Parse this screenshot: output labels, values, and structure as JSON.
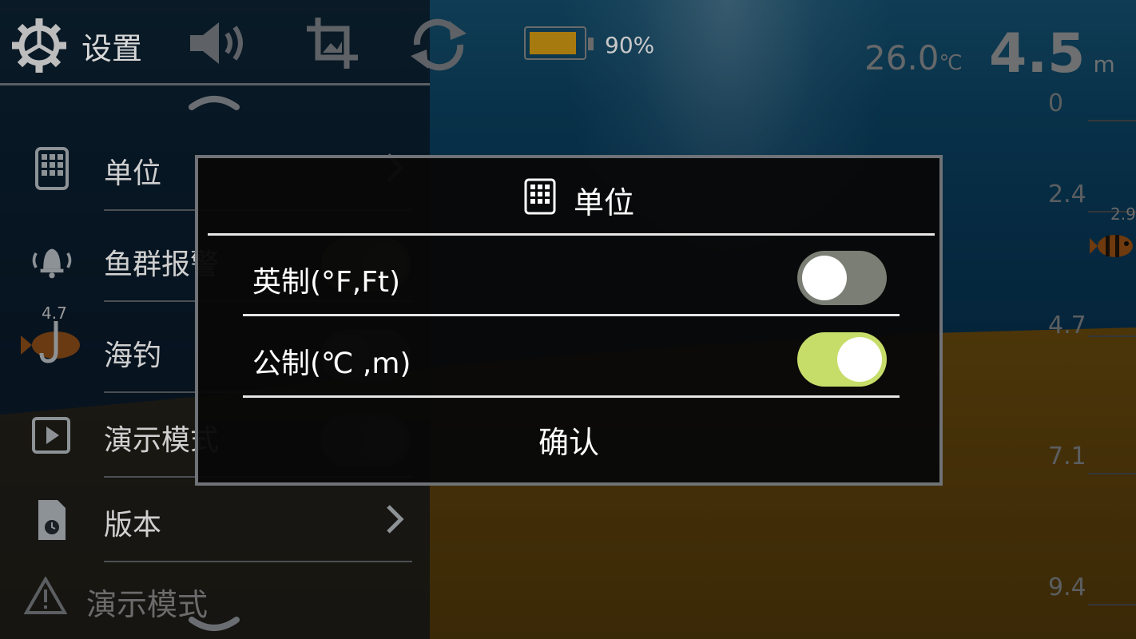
{
  "header": {
    "title": "设置",
    "battery_text": "90%",
    "battery_level": 0.9
  },
  "menu": {
    "items": [
      {
        "label": "单位"
      },
      {
        "label": "鱼群报警"
      },
      {
        "label": "海钓"
      },
      {
        "label": "演示模式"
      },
      {
        "label": "版本"
      }
    ],
    "fish_depth_label": "4.7",
    "demo_banner": "演示模式"
  },
  "readouts": {
    "temperature": "26.0",
    "temperature_unit": "℃",
    "depth": "4.5",
    "depth_unit": "m",
    "fish_depth": "2.9"
  },
  "depth_scale": [
    "0",
    "2.4",
    "4.7",
    "7.1",
    "9.4"
  ],
  "dialog": {
    "title": "单位",
    "options": [
      {
        "label": "英制(°F,Ft)",
        "selected": false
      },
      {
        "label": "公制(℃ ,m)",
        "selected": true
      }
    ],
    "confirm_label": "确认"
  },
  "colors": {
    "toggle_on": "#c7dd6a",
    "toggle_off": "#7b7e74",
    "battery_fill": "#a77a0f"
  }
}
